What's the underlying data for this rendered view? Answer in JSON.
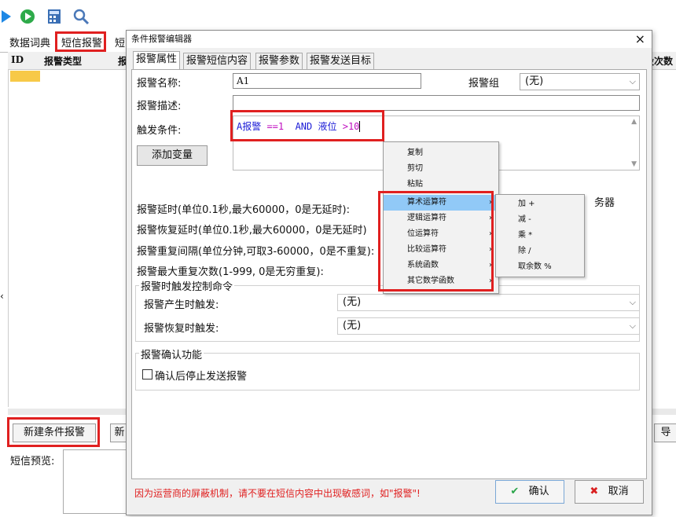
{
  "background": {
    "toolbar": {
      "icons": [
        "play-icon",
        "run-icon",
        "calculator-icon",
        "search-icon"
      ]
    },
    "tabs": [
      "数据词典",
      "短信报警",
      "短"
    ],
    "grid_headers": [
      "ID",
      "报警类型",
      "报"
    ],
    "right_header_text": "设次数",
    "new_button": "新建条件报警",
    "export_button_partial": "导",
    "mid_button_partial": "新",
    "sms_preview_label": "短信预览:",
    "left_arrow": "‹"
  },
  "dialog": {
    "title": "条件报警编辑器",
    "close_label": "×",
    "tabs": [
      "报警属性",
      "报警短信内容",
      "报警参数",
      "报警发送目标"
    ],
    "alarm_name_label": "报警名称:",
    "alarm_name_value": "A1",
    "alarm_group_label": "报警组",
    "alarm_group_value": "(无)",
    "alarm_desc_label": "报警描述:",
    "alarm_desc_value": "",
    "trigger_label": "触发条件:",
    "trigger_expr": {
      "p1": "A报警",
      "p2": " ==1 ",
      "p3": " AND ",
      "p4": "液位",
      "p5": " >10"
    },
    "add_var_button": "添加变量",
    "delay_label": "报警延时(单位0.1秒,最大60000，0是无延时):",
    "recover_delay_label": "报警恢复延时(单位0.1秒,最大60000，0是无延时)",
    "repeat_interval_label": "报警重复间隔(单位分钟,可取3-60000，0是不重复):",
    "max_repeat_label": "报警最大重复次数(1-999, 0是无穷重复):",
    "trigger_cmd_group": "报警时触发控制命令",
    "on_alarm_label": "报警产生时触发:",
    "on_alarm_value": "(无)",
    "on_recover_label": "报警恢复时触发:",
    "on_recover_value": "(无)",
    "confirm_group": "报警确认功能",
    "confirm_checkbox_label": "确认后停止发送报警",
    "server_partial": "务器",
    "warning_text": "因为运营商的屏蔽机制，请不要在短信内容中出现敏感词，如\"报警\"!",
    "ok_button": "确认",
    "cancel_button": "取消"
  },
  "context_menu": {
    "items": [
      "复制",
      "剪切",
      "粘贴"
    ],
    "submenu_items": [
      "算术运算符",
      "逻辑运算符",
      "位运算符",
      "比较运算符",
      "系统函数",
      "其它数学函数"
    ],
    "highlighted": "算术运算符"
  },
  "arith_menu": {
    "items": [
      "加 +",
      "减 -",
      "乘 *",
      "除 /",
      "取余数 %"
    ]
  },
  "colors": {
    "highlight": "#91c9f7",
    "annotation_red": "#e02020",
    "expr_blue": "#1a1ad6",
    "expr_magenta": "#c010c0",
    "warning_red": "#e02020"
  }
}
